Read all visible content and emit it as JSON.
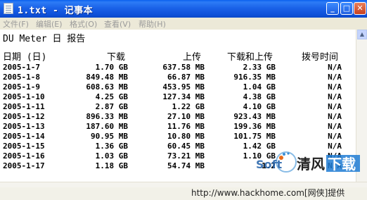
{
  "window": {
    "title": "1.txt - 记事本",
    "buttons": {
      "minimize": "_",
      "maximize": "□",
      "close": "✕"
    },
    "icon": "notepad-icon"
  },
  "menubar": {
    "items": [
      {
        "label": "文件(F)"
      },
      {
        "label": "编辑(E)"
      },
      {
        "label": "格式(O)"
      },
      {
        "label": "查看(V)"
      },
      {
        "label": "帮助(H)"
      }
    ]
  },
  "document": {
    "title": "DU Meter 日 报告",
    "headers": [
      "日期 (日)",
      "下载",
      "上传",
      "下载和上传",
      "拨号时间"
    ],
    "rows": [
      [
        "2005-1-7",
        "1.70 GB",
        "637.58 MB",
        "2.33 GB",
        "N/A"
      ],
      [
        "2005-1-8",
        "849.48 MB",
        "66.87 MB",
        "916.35 MB",
        "N/A"
      ],
      [
        "2005-1-9",
        "608.63 MB",
        "453.95 MB",
        "1.04 GB",
        "N/A"
      ],
      [
        "2005-1-10",
        "4.25 GB",
        "127.34 MB",
        "4.38 GB",
        "N/A"
      ],
      [
        "2005-1-11",
        "2.87 GB",
        "1.22 GB",
        "4.10 GB",
        "N/A"
      ],
      [
        "2005-1-12",
        "896.33 MB",
        "27.10 MB",
        "923.43 MB",
        "N/A"
      ],
      [
        "2005-1-13",
        "187.60 MB",
        "11.76 MB",
        "199.36 MB",
        "N/A"
      ],
      [
        "2005-1-14",
        "90.95 MB",
        "10.80 MB",
        "101.75 MB",
        "N/A"
      ],
      [
        "2005-1-15",
        "1.36 GB",
        "60.45 MB",
        "1.42 GB",
        "N/A"
      ],
      [
        "2005-1-16",
        "1.03 GB",
        "73.21 MB",
        "1.10 GB",
        "N/A"
      ],
      [
        "2005-1-17",
        "1.18 GB",
        "54.74 MB",
        "1.2",
        "N/A"
      ]
    ]
  },
  "watermark": {
    "brand_latin": "Soft",
    "brand_cn": "清风",
    "brand_cn2": "下载",
    "url_text": "http://www.hackhome.com[网侠]提供"
  },
  "colors": {
    "titlebar": "#0f52db",
    "menubar": "#ece9d8",
    "close_button": "#c7401e"
  }
}
